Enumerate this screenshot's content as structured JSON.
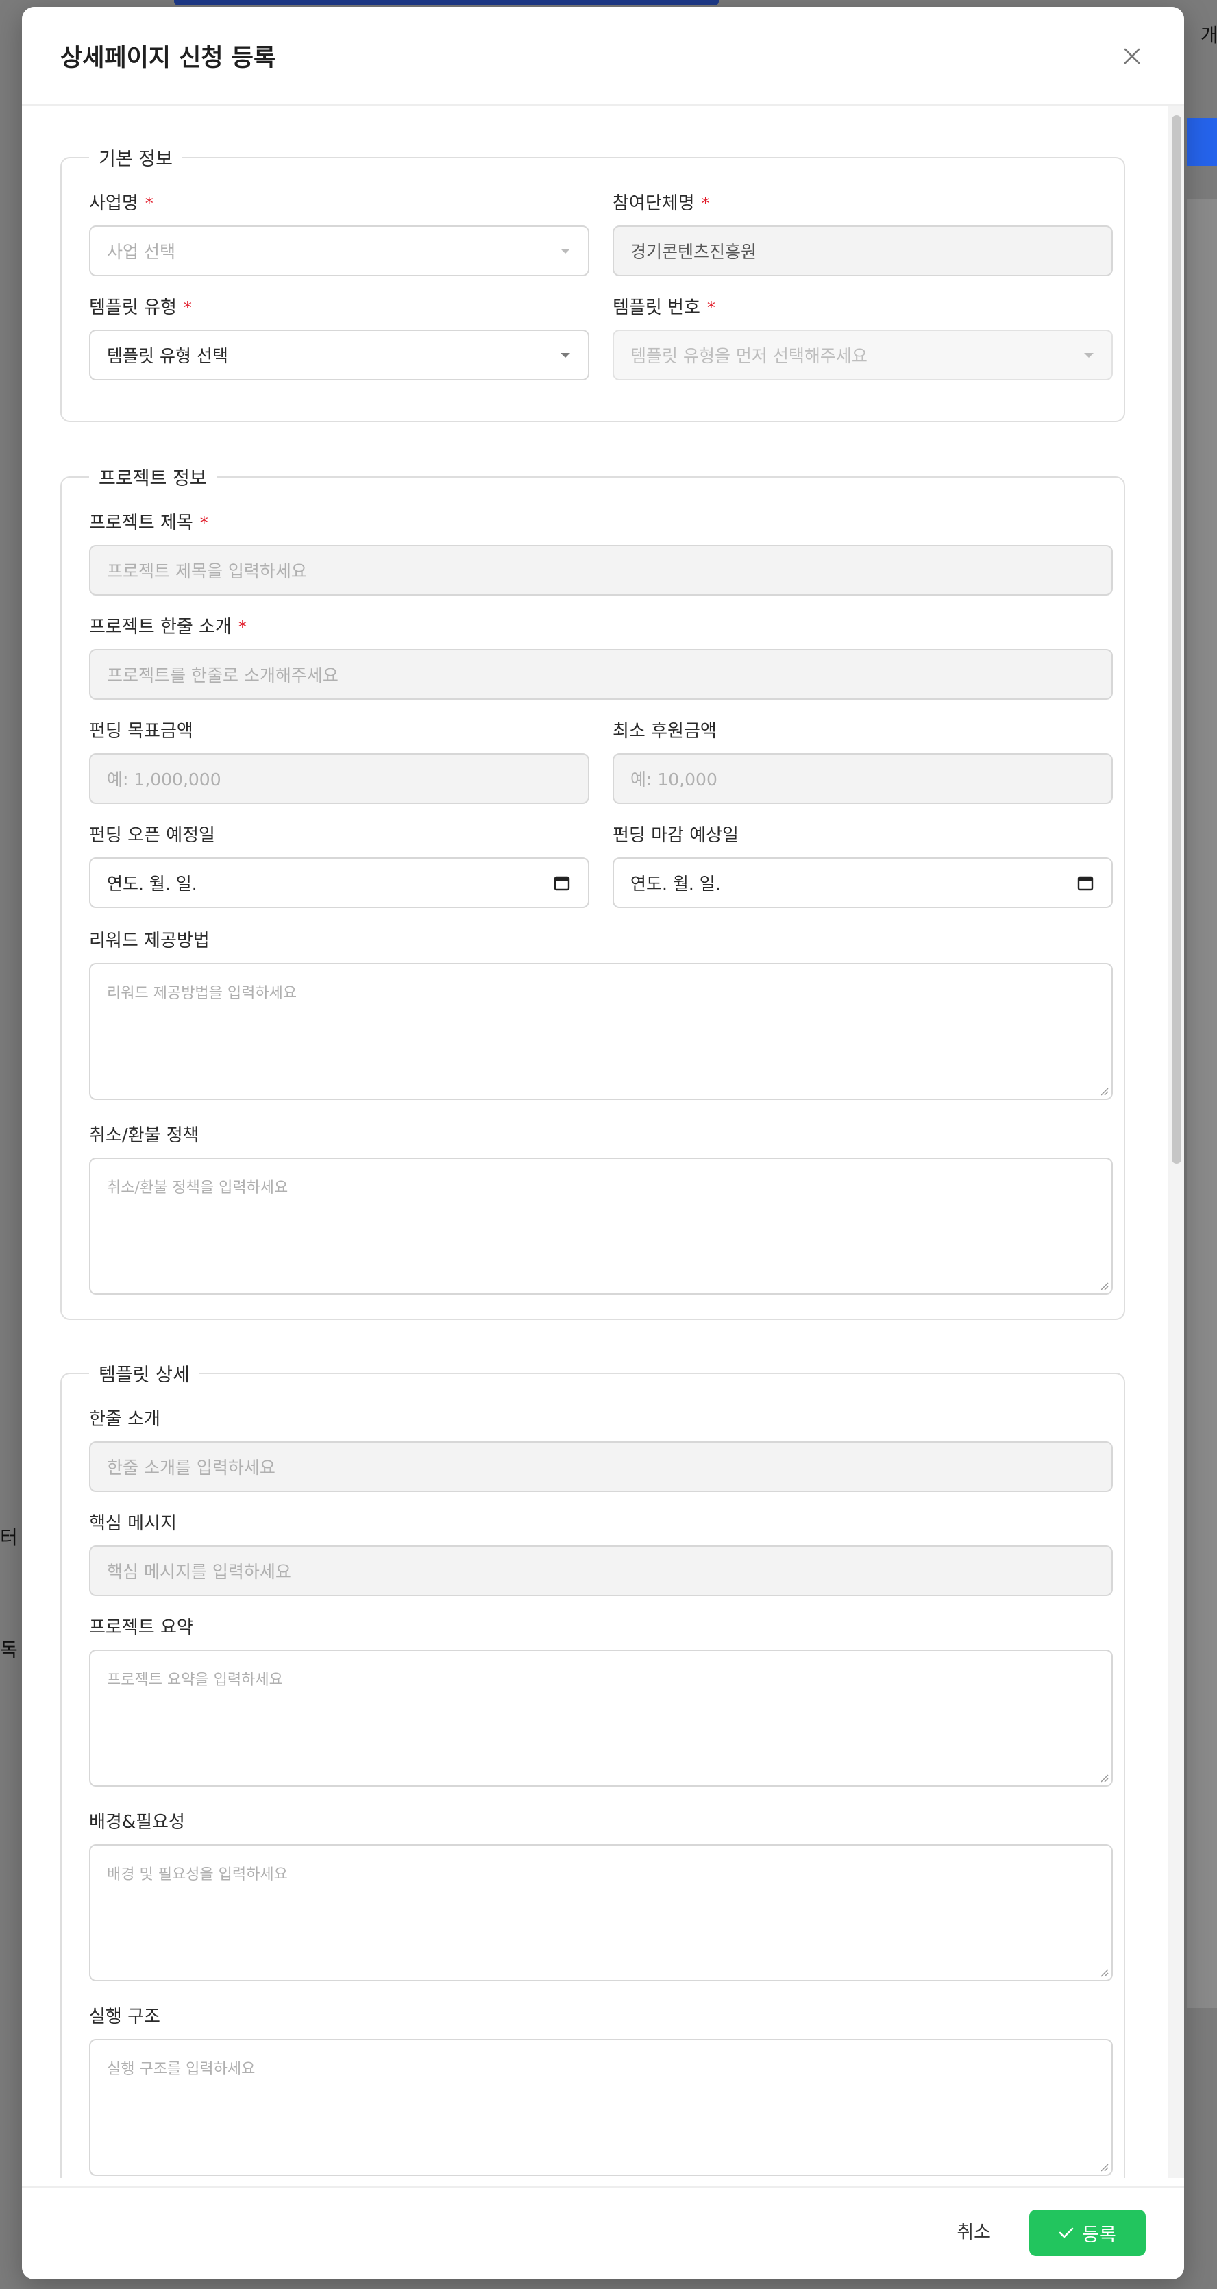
{
  "modal": {
    "title": "상세페이지 신청 등록",
    "close_icon": "close-icon"
  },
  "basic": {
    "legend": "기본 정보",
    "business_label": "사업명",
    "business_placeholder": "사업 선택",
    "org_label": "참여단체명",
    "org_value": "경기콘텐츠진흥원",
    "template_type_label": "템플릿 유형",
    "template_type_value": "템플릿 유형 선택",
    "template_no_label": "템플릿 번호",
    "template_no_placeholder": "템플릿 유형을 먼저 선택해주세요",
    "required_mark": "*"
  },
  "project": {
    "legend": "프로젝트 정보",
    "title_label": "프로젝트 제목",
    "title_placeholder": "프로젝트 제목을 입력하세요",
    "oneline_label": "프로젝트 한줄 소개",
    "oneline_placeholder": "프로젝트를 한줄로 소개해주세요",
    "goal_label": "펀딩 목표금액",
    "goal_placeholder": "예: 1,000,000",
    "min_label": "최소 후원금액",
    "min_placeholder": "예: 10,000",
    "open_label": "펀딩 오픈 예정일",
    "open_value": "연도. 월. 일.",
    "close_label": "펀딩 마감 예상일",
    "close_value": "연도. 월. 일.",
    "reward_label": "리워드 제공방법",
    "reward_placeholder": "리워드 제공방법을 입력하세요",
    "refund_label": "취소/환불 정책",
    "refund_placeholder": "취소/환불 정책을 입력하세요"
  },
  "template": {
    "legend": "템플릿 상세",
    "intro_label": "한줄 소개",
    "intro_placeholder": "한줄 소개를 입력하세요",
    "message_label": "핵심 메시지",
    "message_placeholder": "핵심 메시지를 입력하세요",
    "summary_label": "프로젝트 요약",
    "summary_placeholder": "프로젝트 요약을 입력하세요",
    "background_label": "배경&필요성",
    "background_placeholder": "배경 및 필요성을 입력하세요",
    "structure_label": "실행 구조",
    "structure_placeholder": "실행 구조를 입력하세요"
  },
  "footer": {
    "cancel_label": "취소",
    "submit_label": "등록",
    "submit_icon": "check-icon",
    "submit_color": "#22c55e"
  },
  "background_page": {
    "fragments": [
      "개",
      "터",
      "독"
    ]
  }
}
